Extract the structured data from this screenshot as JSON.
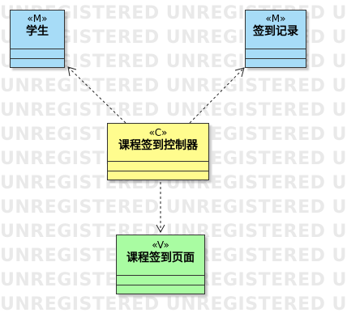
{
  "watermark": {
    "text": "UNREGISTERED UNREGISTERED UNREGISTERED",
    "line_count": 13
  },
  "colors": {
    "model_fill": "#a7dcf7",
    "controller_fill": "#fffc8e",
    "view_fill": "#a9fca2",
    "border": "#333333",
    "watermark": "#e9e9e9"
  },
  "classes": {
    "student": {
      "stereotype": "«M»",
      "name": "学生"
    },
    "attendance_record": {
      "stereotype": "«M»",
      "name": "签到记录"
    },
    "course_attendance_controller": {
      "stereotype": "«C»",
      "name": "课程签到控制器"
    },
    "course_attendance_page": {
      "stereotype": "«V»",
      "name": "课程签到页面"
    }
  },
  "edges": [
    {
      "from": "course_attendance_controller",
      "to": "student",
      "style": "dashed-arrow"
    },
    {
      "from": "course_attendance_controller",
      "to": "attendance_record",
      "style": "dashed-arrow"
    },
    {
      "from": "course_attendance_controller",
      "to": "course_attendance_page",
      "style": "dashed-arrow"
    }
  ]
}
